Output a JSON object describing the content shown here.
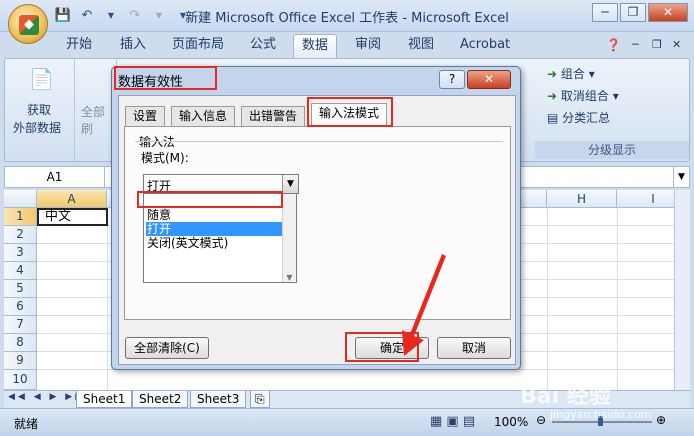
{
  "window": {
    "title": "新建 Microsoft Office Excel 工作表 - Microsoft Excel",
    "minimize": "─",
    "restore": "❐",
    "close": "✕"
  },
  "quick_access": {
    "save_icon": "save-icon",
    "undo_icon": "undo-icon",
    "redo_icon": "redo-icon"
  },
  "ribbon": {
    "tabs": [
      "开始",
      "插入",
      "页面布局",
      "公式",
      "数据",
      "审阅",
      "视图",
      "Acrobat"
    ],
    "active_tab": "数据",
    "get_external": "获取",
    "get_external_2": "外部数据",
    "refresh_all": "全部刷",
    "group": "组合",
    "ungroup": "取消组合",
    "subtotal": "分类汇总",
    "outline_label": "分级显示"
  },
  "formula_bar": {
    "name_box": "A1"
  },
  "grid": {
    "columns": [
      "A",
      "H",
      "I"
    ],
    "rows": [
      "1",
      "2",
      "3",
      "4",
      "5",
      "6",
      "7",
      "8",
      "9",
      "10"
    ],
    "cell_a1": "中文"
  },
  "sheets": [
    "Sheet1",
    "Sheet2",
    "Sheet3"
  ],
  "status": {
    "ready": "就绪",
    "zoom": "100%"
  },
  "dialog": {
    "title": "数据有效性",
    "help": "?",
    "close": "✕",
    "tabs": [
      "设置",
      "输入信息",
      "出错警告",
      "输入法模式"
    ],
    "active_tab": "输入法模式",
    "section_label": "输入法",
    "mode_label": "模式(M):",
    "combo_value": "打开",
    "options": [
      "随意",
      "打开",
      "关闭(英文模式)"
    ],
    "selected_option": "打开",
    "clear_all": "全部清除(C)",
    "ok": "确定",
    "cancel": "取消"
  },
  "watermark": {
    "brand": "Bai 经验",
    "url": "jingyan.baidu.com"
  },
  "colors": {
    "highlight": "#e8281e",
    "selection": "#3296ff"
  }
}
